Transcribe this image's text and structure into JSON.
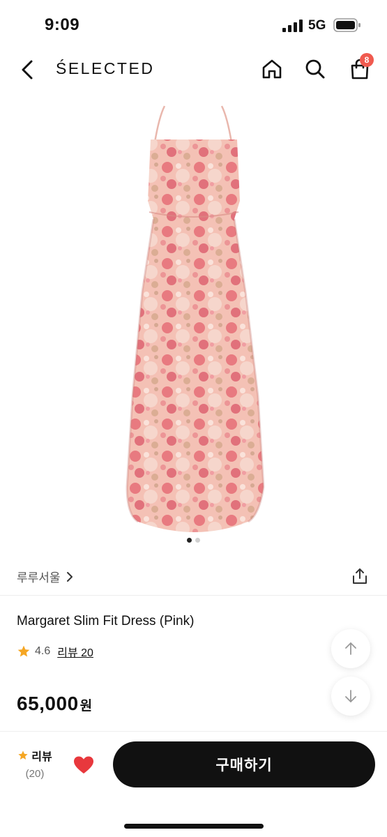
{
  "status_bar": {
    "time": "9:09",
    "network": "5G"
  },
  "header": {
    "brand": "ŚELECTED",
    "cart_count": "8"
  },
  "icons": {
    "back": "chevron-left-icon",
    "home": "home-icon",
    "search": "search-icon",
    "cart": "shopping-bag-icon",
    "share": "share-icon",
    "star": "star-icon",
    "heart": "heart-icon"
  },
  "gallery": {
    "current_index": 1,
    "total": 2
  },
  "seller": {
    "name": "루루서울"
  },
  "product": {
    "title": "Margaret Slim Fit Dress (Pink)",
    "rating": "4.6",
    "review_label": "리뷰 20",
    "price": "65,000",
    "currency": "원"
  },
  "bottom_bar": {
    "review_label": "리뷰",
    "review_count": "(20)",
    "buy_label": "구매하기"
  },
  "colors": {
    "badge": "#f05a4f",
    "star": "#f5a623",
    "heart": "#e8383d",
    "buy_button": "#111111",
    "dress_base": "#f2b8ad",
    "dress_flower": "#e05a6a"
  }
}
